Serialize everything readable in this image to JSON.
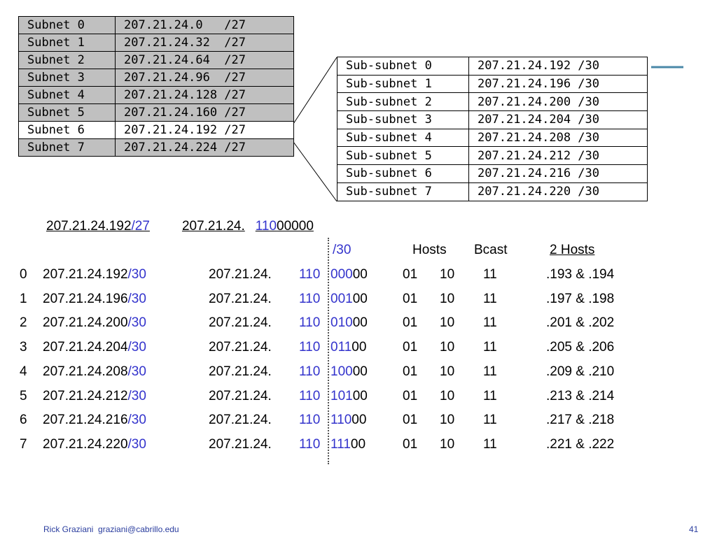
{
  "subnets": [
    {
      "name": "Subnet 0",
      "addr": "207.21.24.0   /27",
      "highlighted": false
    },
    {
      "name": "Subnet 1",
      "addr": "207.21.24.32  /27",
      "highlighted": false
    },
    {
      "name": "Subnet 2",
      "addr": "207.21.24.64  /27",
      "highlighted": false
    },
    {
      "name": "Subnet 3",
      "addr": "207.21.24.96  /27",
      "highlighted": false
    },
    {
      "name": "Subnet 4",
      "addr": "207.21.24.128 /27",
      "highlighted": false
    },
    {
      "name": "Subnet 5",
      "addr": "207.21.24.160 /27",
      "highlighted": false
    },
    {
      "name": "Subnet 6",
      "addr": "207.21.24.192 /27",
      "highlighted": true
    },
    {
      "name": "Subnet 7",
      "addr": "207.21.24.224 /27",
      "highlighted": false
    }
  ],
  "subsubnets": [
    {
      "name": "Sub-subnet 0",
      "addr": "207.21.24.192 /30"
    },
    {
      "name": "Sub-subnet 1",
      "addr": "207.21.24.196 /30"
    },
    {
      "name": "Sub-subnet 2",
      "addr": "207.21.24.200 /30"
    },
    {
      "name": "Sub-subnet 3",
      "addr": "207.21.24.204 /30"
    },
    {
      "name": "Sub-subnet 4",
      "addr": "207.21.24.208 /30"
    },
    {
      "name": "Sub-subnet 5",
      "addr": "207.21.24.212 /30"
    },
    {
      "name": "Sub-subnet 6",
      "addr": "207.21.24.216 /30"
    },
    {
      "name": "Sub-subnet 7",
      "addr": "207.21.24.220 /30"
    }
  ],
  "header": {
    "net": "207.21.24.192",
    "prefix": "/27",
    "binary_prefix": "207.21.24.",
    "binary_blue": "110",
    "binary_rest": "00000"
  },
  "columns": {
    "slash30": "/30",
    "hosts": "Hosts",
    "bcast": "Bcast",
    "two_hosts": "2 Hosts"
  },
  "rows": [
    {
      "idx": "0",
      "net": "207.21.24.192",
      "mask": "/30",
      "bin_prefix": "207.21.24.",
      "bin_fixed": "110",
      "bin_sub": "000",
      "bin_tail": "00",
      "host1": "01",
      "host2": "10",
      "bcast": "11",
      "hosts": ".193 & .194"
    },
    {
      "idx": "1",
      "net": "207.21.24.196",
      "mask": "/30",
      "bin_prefix": "207.21.24.",
      "bin_fixed": "110",
      "bin_sub": "001",
      "bin_tail": "00",
      "host1": "01",
      "host2": "10",
      "bcast": "11",
      "hosts": ".197 & .198"
    },
    {
      "idx": "2",
      "net": "207.21.24.200",
      "mask": "/30",
      "bin_prefix": "207.21.24.",
      "bin_fixed": "110",
      "bin_sub": "010",
      "bin_tail": "00",
      "host1": "01",
      "host2": "10",
      "bcast": "11",
      "hosts": ".201 & .202"
    },
    {
      "idx": "3",
      "net": "207.21.24.204",
      "mask": "/30",
      "bin_prefix": "207.21.24.",
      "bin_fixed": "110",
      "bin_sub": "011",
      "bin_tail": "00",
      "host1": "01",
      "host2": "10",
      "bcast": "11",
      "hosts": ".205 & .206"
    },
    {
      "idx": "4",
      "net": "207.21.24.208",
      "mask": "/30",
      "bin_prefix": "207.21.24.",
      "bin_fixed": "110",
      "bin_sub": "100",
      "bin_tail": "00",
      "host1": "01",
      "host2": "10",
      "bcast": "11",
      "hosts": ".209 & .210"
    },
    {
      "idx": "5",
      "net": "207.21.24.212",
      "mask": "/30",
      "bin_prefix": "207.21.24.",
      "bin_fixed": "110",
      "bin_sub": "101",
      "bin_tail": "00",
      "host1": "01",
      "host2": "10",
      "bcast": "11",
      "hosts": ".213 & .214"
    },
    {
      "idx": "6",
      "net": "207.21.24.216",
      "mask": "/30",
      "bin_prefix": "207.21.24.",
      "bin_fixed": "110",
      "bin_sub": "110",
      "bin_tail": "00",
      "host1": "01",
      "host2": "10",
      "bcast": "11",
      "hosts": ".217 & .218"
    },
    {
      "idx": "7",
      "net": "207.21.24.220",
      "mask": "/30",
      "bin_prefix": "207.21.24.",
      "bin_fixed": "110",
      "bin_sub": "111",
      "bin_tail": "00",
      "host1": "01",
      "host2": "10",
      "bcast": "11",
      "hosts": ".221 & .222"
    }
  ],
  "footer": {
    "author": "Rick Graziani",
    "email": "graziani@cabrillo.edu",
    "page": "41"
  },
  "colors": {
    "accent_blue": "#3333cc",
    "shaded_cell": "#c0c0c0",
    "footer_text": "#2a3d9e",
    "deco_line": "#4a88a8"
  }
}
